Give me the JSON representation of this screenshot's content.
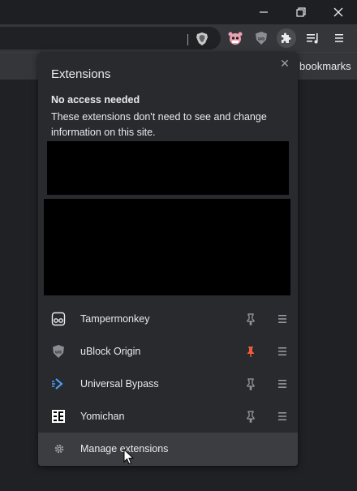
{
  "titlebar": {
    "minimize_icon": "minimize-icon",
    "restore_icon": "restore-icon",
    "close_icon": "close-icon"
  },
  "toolbar": {
    "omnibox_value": "",
    "icons": [
      "brave-shield-icon",
      "tampermonkey-toolbar-icon",
      "ublock-toolbar-icon",
      "extensions-puzzle-icon",
      "media-queue-icon",
      "menu-kebab-icon"
    ]
  },
  "bookmarks_bar": {
    "partial_text": "bookmarks"
  },
  "popup": {
    "title": "Extensions",
    "close_glyph": "✕",
    "section_heading": "No access needed",
    "section_description": "These extensions don't need to see and change information on this site.",
    "extensions": [
      {
        "name": "Tampermonkey",
        "pinned": false
      },
      {
        "name": "uBlock Origin",
        "pinned": true
      },
      {
        "name": "Universal Bypass",
        "pinned": false
      },
      {
        "name": "Yomichan",
        "pinned": false
      }
    ],
    "manage_label": "Manage extensions"
  },
  "colors": {
    "background": "#202124",
    "toolbar": "#35363a",
    "popup": "#292a2d",
    "manage_hover": "#3c3d41",
    "pinned_accent": "#f05a3a"
  }
}
